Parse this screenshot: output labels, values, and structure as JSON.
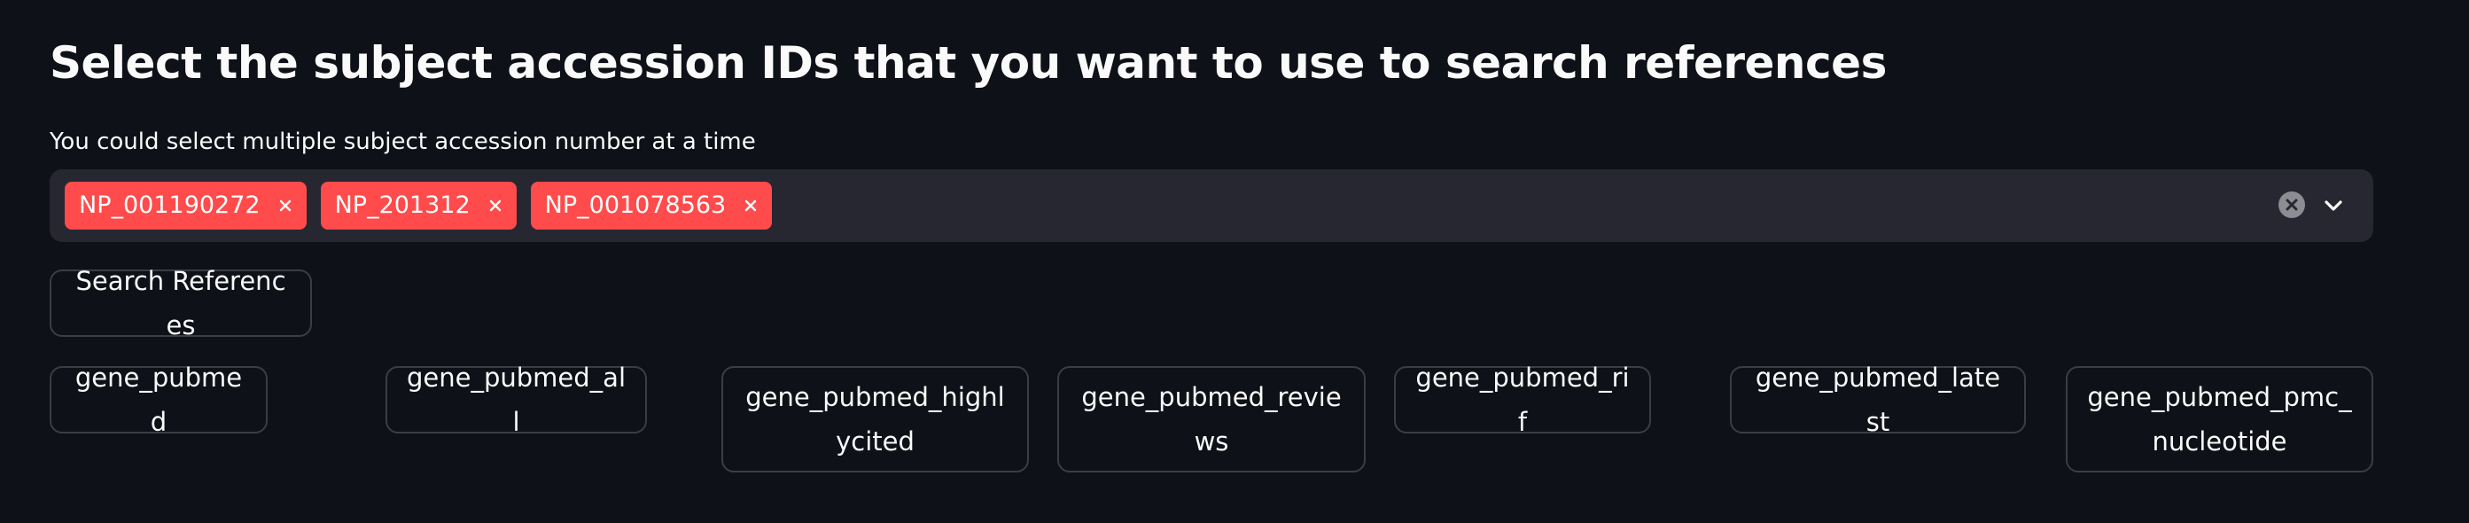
{
  "page": {
    "title": "Select the subject accession IDs that you want to use to search references"
  },
  "multiselect": {
    "label": "You could select multiple subject accession number at a time",
    "selected": [
      {
        "label": "NP_001190272"
      },
      {
        "label": "NP_201312"
      },
      {
        "label": "NP_001078563"
      }
    ],
    "clear_icon": "circle-x-icon",
    "dropdown_icon": "chevron-down-icon"
  },
  "actions": {
    "search_label": "Search References"
  },
  "database_buttons": [
    {
      "label": "gene_pubmed"
    },
    {
      "label": "gene_pubmed_all"
    },
    {
      "label": "gene_pubmed_highlycited"
    },
    {
      "label": "gene_pubmed_reviews"
    },
    {
      "label": "gene_pubmed_rif"
    },
    {
      "label": "gene_pubmed_latest"
    },
    {
      "label": "gene_pubmed_pmc_nucleotide"
    }
  ],
  "colors": {
    "background": "#0e1117",
    "chip": "#ff4b4b",
    "input_bg": "#262730",
    "border": "#3b3d46",
    "text": "#fafafa"
  }
}
